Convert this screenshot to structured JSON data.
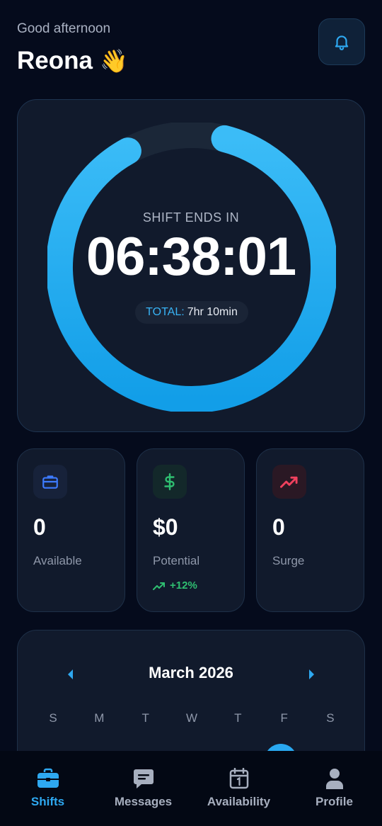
{
  "header": {
    "greeting": "Good afternoon",
    "name": "Reona",
    "emoji": "👋",
    "bell_icon": "bell-icon"
  },
  "timer": {
    "label": "SHIFT ENDS IN",
    "value": "06:38:01",
    "total_key": "TOTAL:",
    "total_value": "7hr 10min",
    "progress": 0.92,
    "ring_color_start": "#3bbcf7",
    "ring_color_end": "#129ee8"
  },
  "stats": [
    {
      "icon": "briefcase-icon",
      "value": "0",
      "label": "Available",
      "accent": "#3d7bff"
    },
    {
      "icon": "dollar-icon",
      "value": "$0",
      "label": "Potential",
      "trend": "+12%",
      "accent": "#2fbf71"
    },
    {
      "icon": "trending-up-icon",
      "value": "0",
      "label": "Surge",
      "accent": "#f0415e"
    }
  ],
  "calendar": {
    "title": "March 2026",
    "weekdays": [
      "S",
      "M",
      "T",
      "W",
      "T",
      "F",
      "S"
    ]
  },
  "nav": {
    "active": "Shifts",
    "items": [
      {
        "label": "Shifts",
        "icon": "briefcase-icon"
      },
      {
        "label": "Messages",
        "icon": "chat-icon"
      },
      {
        "label": "Availability",
        "icon": "calendar-icon"
      },
      {
        "label": "Profile",
        "icon": "user-icon"
      }
    ]
  }
}
